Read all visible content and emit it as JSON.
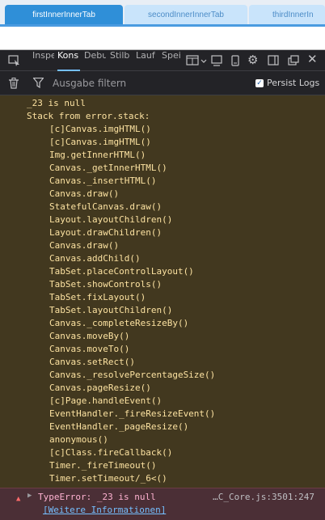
{
  "app_tabs": [
    "firstInnerInnerTab",
    "secondInnerInnerTab",
    "thirdInnerIn"
  ],
  "devtools_tabs": [
    "Inspe",
    "Kons",
    "Debu",
    "Stilb",
    "Lauf",
    "Spei"
  ],
  "filter_placeholder": "Ausgabe filtern",
  "persist_logs_label": "Persist Logs",
  "persist_logs_checked": true,
  "log_lines": [
    {
      "text": "_23 is null",
      "indent": 0
    },
    {
      "text": "Stack from error.stack:",
      "indent": 0
    },
    {
      "text": "[c]Canvas.imgHTML()",
      "indent": 1
    },
    {
      "text": "[c]Canvas.imgHTML()",
      "indent": 1
    },
    {
      "text": "Img.getInnerHTML()",
      "indent": 1
    },
    {
      "text": "Canvas._getInnerHTML()",
      "indent": 1
    },
    {
      "text": "Canvas._insertHTML()",
      "indent": 1
    },
    {
      "text": "Canvas.draw()",
      "indent": 1
    },
    {
      "text": "StatefulCanvas.draw()",
      "indent": 1
    },
    {
      "text": "Layout.layoutChildren()",
      "indent": 1
    },
    {
      "text": "Layout.drawChildren()",
      "indent": 1
    },
    {
      "text": "Canvas.draw()",
      "indent": 1
    },
    {
      "text": "Canvas.addChild()",
      "indent": 1
    },
    {
      "text": "TabSet.placeControlLayout()",
      "indent": 1
    },
    {
      "text": "TabSet.showControls()",
      "indent": 1
    },
    {
      "text": "TabSet.fixLayout()",
      "indent": 1
    },
    {
      "text": "TabSet.layoutChildren()",
      "indent": 1
    },
    {
      "text": "Canvas._completeResizeBy()",
      "indent": 1
    },
    {
      "text": "Canvas.moveBy()",
      "indent": 1
    },
    {
      "text": "Canvas.moveTo()",
      "indent": 1
    },
    {
      "text": "Canvas.setRect()",
      "indent": 1
    },
    {
      "text": "Canvas._resolvePercentageSize()",
      "indent": 1
    },
    {
      "text": "Canvas.pageResize()",
      "indent": 1
    },
    {
      "text": "[c]Page.handleEvent()",
      "indent": 1
    },
    {
      "text": "EventHandler._fireResizeEvent()",
      "indent": 1
    },
    {
      "text": "EventHandler._pageResize()",
      "indent": 1
    },
    {
      "text": "anonymous()",
      "indent": 1
    },
    {
      "text": "[c]Class.fireCallback()",
      "indent": 1
    },
    {
      "text": "Timer._fireTimeout()",
      "indent": 1
    },
    {
      "text": "Timer.setTimeout/_6<()",
      "indent": 1
    }
  ],
  "error": {
    "message": "TypeError: _23 is null",
    "source": "…C_Core.js:3501:247",
    "more_info": "[Weitere Informationen]"
  },
  "colors": {
    "active_tab": "#2f8fd8",
    "log_text": "#fce2a1",
    "log_background": "#42381f",
    "error_text": "#ffb3d2",
    "link": "#75bfff"
  }
}
